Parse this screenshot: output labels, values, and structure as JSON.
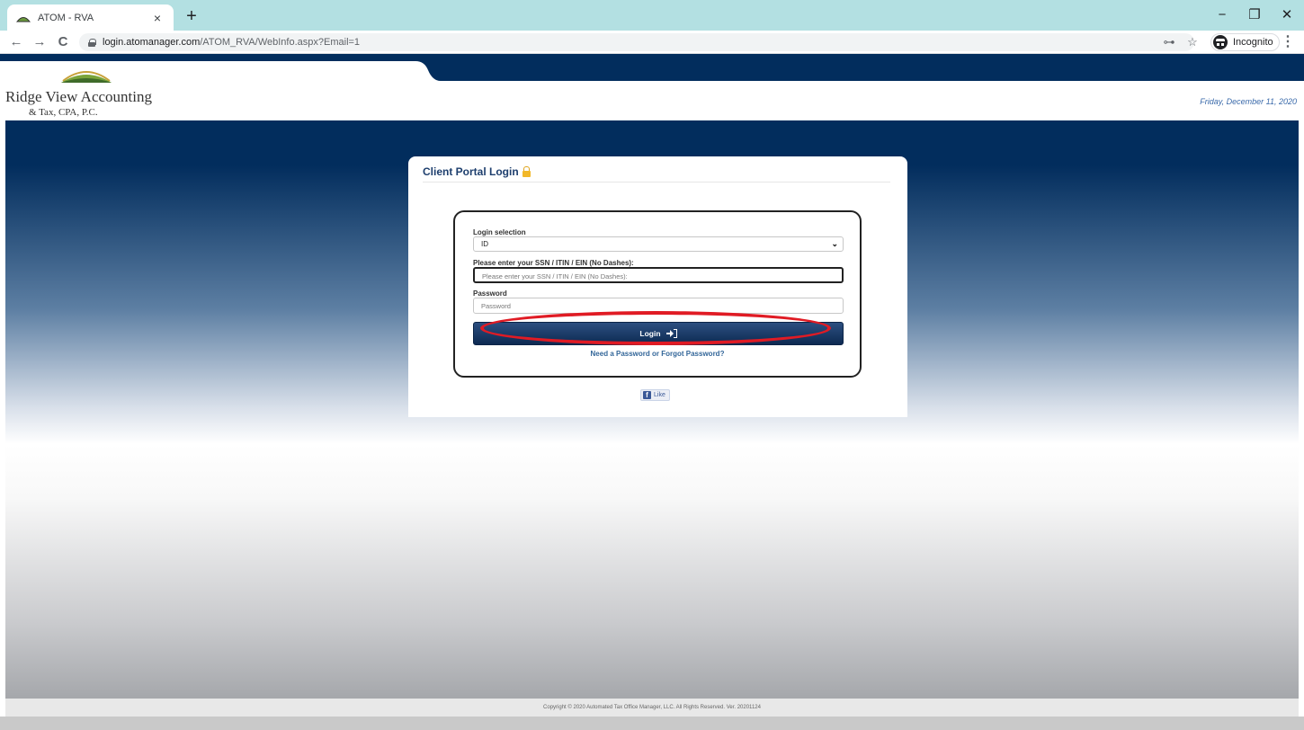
{
  "browser": {
    "tab_title": "ATOM - RVA",
    "tab_close": "×",
    "new_tab": "+",
    "url_host": "login.atomanager.com",
    "url_path": "/ATOM_RVA/WebInfo.aspx?Email=1",
    "incognito_label": "Incognito",
    "nav": {
      "back": "←",
      "forward": "→",
      "reload": "C"
    },
    "window": {
      "minimize": "−",
      "restore": "❐",
      "close": "✕"
    },
    "icons": {
      "key": "⊶",
      "star": "☆",
      "menu": "⋮"
    }
  },
  "header": {
    "brand_name": "Ridge View Accounting",
    "brand_sub": "& Tax, CPA, P.C.",
    "date": "Friday, December 11, 2020"
  },
  "login_card": {
    "title": "Client Portal Login",
    "selection_label": "Login selection",
    "selection_value": "ID",
    "ssn_label": "Please enter your SSN / ITIN / EIN (No Dashes):",
    "ssn_placeholder": "Please enter your SSN / ITIN / EIN (No Dashes):",
    "password_label": "Password",
    "password_placeholder": "Password",
    "login_button": "Login",
    "forgot_link": "Need a Password or Forgot Password?",
    "fb_like": "Like"
  },
  "footer": {
    "copyright": "Copyright © 2020 Automated Tax Office Manager, LLC. All Rights Reserved. Ver. 20201124"
  },
  "colors": {
    "navy": "#022d5d",
    "link": "#336699",
    "highlight": "#e01b24",
    "tabstrip": "#b3e0e2"
  }
}
